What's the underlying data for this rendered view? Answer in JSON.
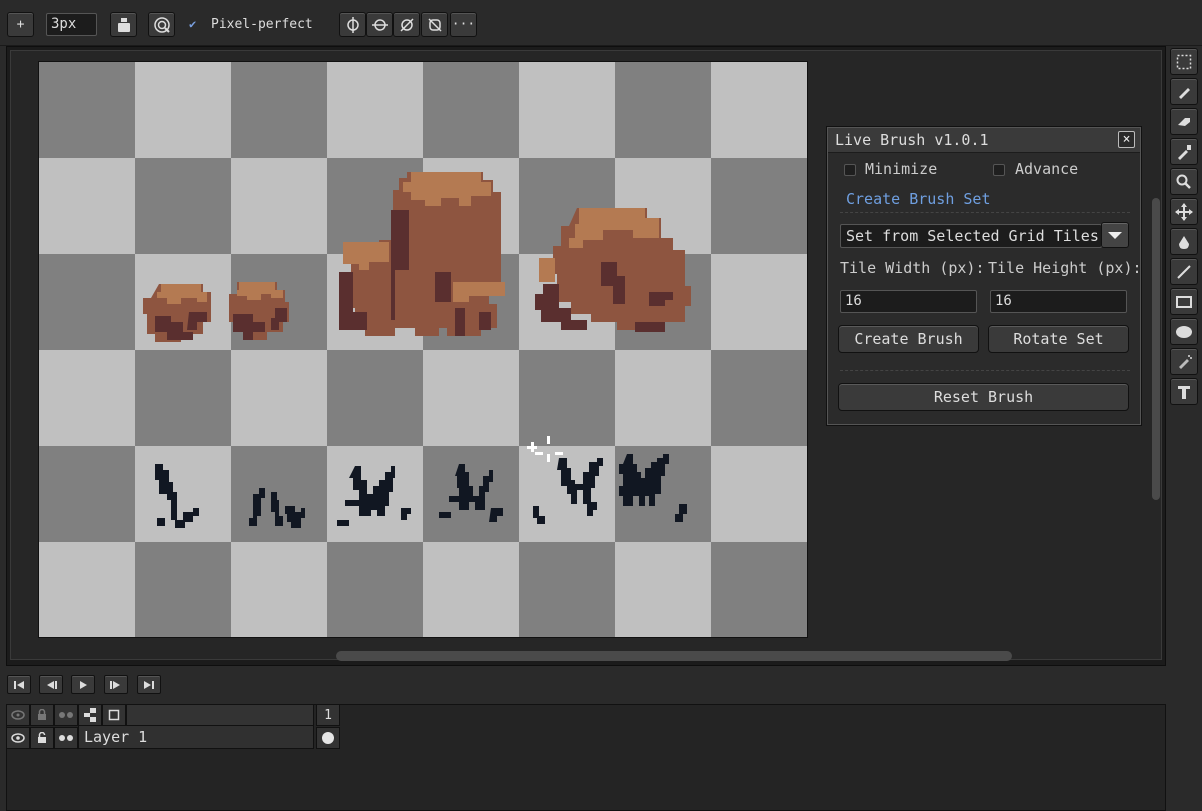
{
  "toolbar": {
    "brush_size": "3px",
    "pixel_perfect_label": "Pixel-perfect",
    "pixel_perfect_checked": true,
    "more_label": "···",
    "add_label": "+"
  },
  "tools": [
    "rectangle-select-icon",
    "pencil-icon",
    "eraser-icon",
    "eyedropper-icon",
    "zoom-icon",
    "move-icon",
    "paint-bucket-icon",
    "line-icon",
    "rectangle-icon",
    "ellipse-icon",
    "spray-icon",
    "text-icon"
  ],
  "live_brush": {
    "title": "Live Brush v1.0.1",
    "close_label": "×",
    "minimize_label": "Minimize",
    "advance_label": "Advance",
    "create_set_link": "Create Brush Set",
    "set_source": "Set from Selected Grid Tiles",
    "tile_width_label": "Tile Width (px):",
    "tile_height_label": "Tile Height (px):",
    "tile_width": "16",
    "tile_height": "16",
    "create_brush": "Create Brush",
    "rotate_set": "Rotate Set",
    "reset_brush": "Reset Brush"
  },
  "timeline": {
    "frame_number": "1",
    "layer_name": "Layer 1"
  },
  "colors": {
    "checker_light": "#c0c0c0",
    "checker_dark": "#808080",
    "rock_light": "#b47a52",
    "rock_mid": "#8e5540",
    "rock_dark": "#5a2f2f",
    "grass": "#111722",
    "link": "#6f9fe0"
  }
}
